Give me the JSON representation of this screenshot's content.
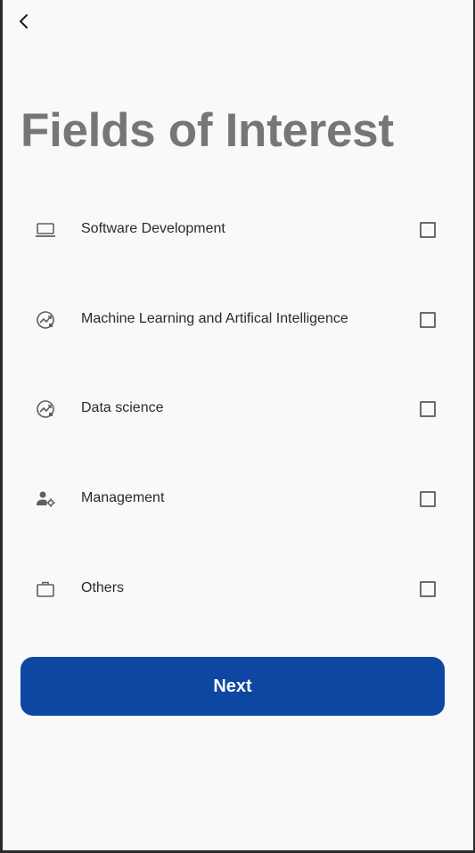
{
  "header": {
    "back_icon": "chevron-left-icon"
  },
  "title": "Fields of Interest",
  "fields": [
    {
      "label": "Software Development",
      "icon": "laptop-icon",
      "checked": false
    },
    {
      "label": "Machine Learning and Artifical Intelligence",
      "icon": "analytics-chart-icon",
      "checked": false
    },
    {
      "label": "Data science",
      "icon": "analytics-chart-icon",
      "checked": false
    },
    {
      "label": "Management",
      "icon": "manage-accounts-icon",
      "checked": false
    },
    {
      "label": "Others",
      "icon": "briefcase-icon",
      "checked": false
    }
  ],
  "next_button": {
    "label": "Next"
  },
  "colors": {
    "primary": "#0d47a1",
    "title": "#767676",
    "background": "#f9f9f9"
  }
}
